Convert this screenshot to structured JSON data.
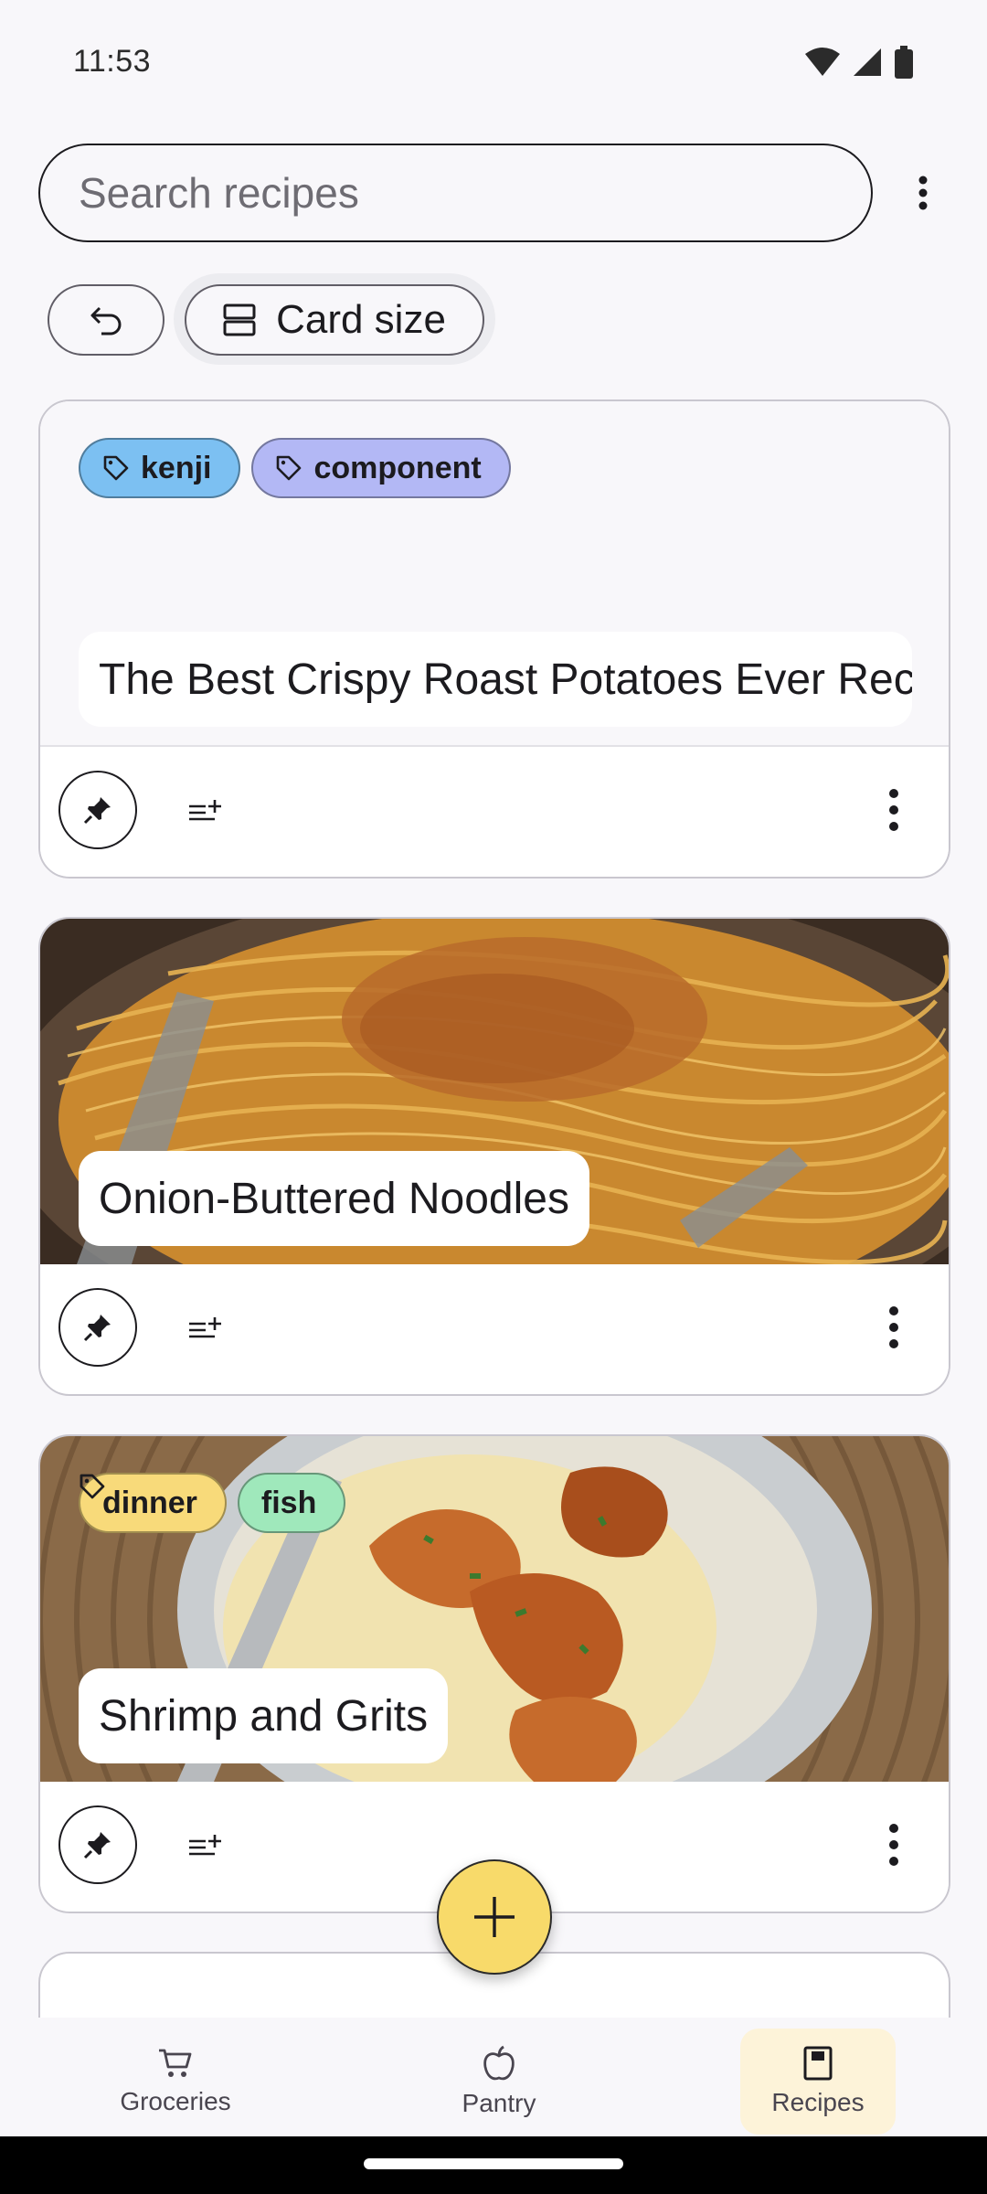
{
  "status_bar": {
    "time": "11:53"
  },
  "search": {
    "placeholder": "Search recipes"
  },
  "toolbar": {
    "card_size_label": "Card size"
  },
  "recipes": [
    {
      "title": "The Best Crispy Roast Potatoes Ever Recipe",
      "tags": [
        "kenji",
        "component"
      ],
      "has_image": false
    },
    {
      "title": "Onion-Buttered Noodles",
      "tags": [],
      "has_image": true
    },
    {
      "title": "Shrimp and Grits",
      "tags": [
        "dinner",
        "fish"
      ],
      "has_image": true
    }
  ],
  "bottom_nav": {
    "items": [
      {
        "label": "Groceries",
        "icon": "cart-icon"
      },
      {
        "label": "Pantry",
        "icon": "apple-icon"
      },
      {
        "label": "Recipes",
        "icon": "book-icon",
        "selected": true
      }
    ]
  },
  "colors": {
    "accent": "#f8da6a",
    "tag_kenji": "#7cc0f2",
    "tag_component": "#b3b8f5",
    "tag_dinner": "#f8da7a",
    "tag_fish": "#9fe8bb",
    "nav_selected": "#fdf3d9"
  }
}
